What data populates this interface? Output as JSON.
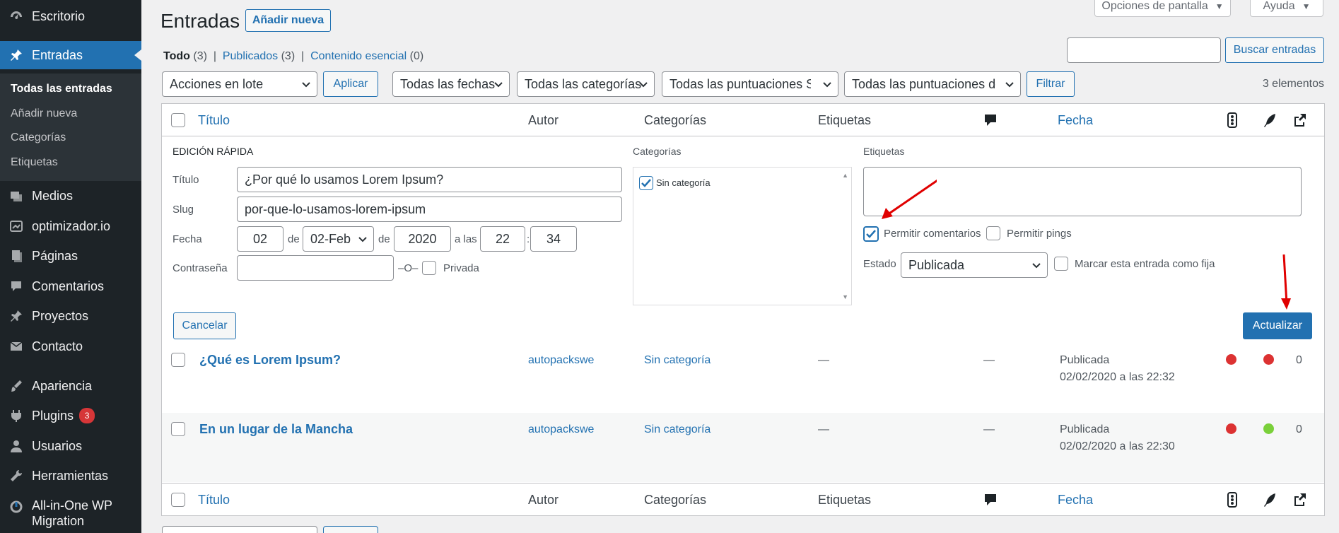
{
  "sidebar": {
    "menu": [
      {
        "label": "Escritorio",
        "icon": "dashboard-icon"
      },
      {
        "label": "Entradas",
        "icon": "pin-icon"
      },
      {
        "label": "Medios",
        "icon": "media-icon"
      },
      {
        "label": "optimizador.io",
        "icon": "optimizer-icon"
      },
      {
        "label": "Páginas",
        "icon": "pages-icon"
      },
      {
        "label": "Comentarios",
        "icon": "comments-icon"
      },
      {
        "label": "Proyectos",
        "icon": "pin-icon"
      },
      {
        "label": "Contacto",
        "icon": "mail-icon"
      },
      {
        "label": "Apariencia",
        "icon": "brush-icon"
      },
      {
        "label": "Plugins",
        "icon": "plugin-icon",
        "badge": "3"
      },
      {
        "label": "Usuarios",
        "icon": "user-icon"
      },
      {
        "label": "Herramientas",
        "icon": "wrench-icon"
      },
      {
        "label": "All-in-One WP Migration",
        "icon": "migration-icon"
      }
    ],
    "submenu": [
      "Todas las entradas",
      "Añadir nueva",
      "Categorías",
      "Etiquetas"
    ]
  },
  "header": {
    "title": "Entradas",
    "add_new": "Añadir nueva",
    "screen_options": "Opciones de pantalla",
    "help": "Ayuda",
    "search_button": "Buscar entradas"
  },
  "views": [
    {
      "label": "Todo",
      "count": "(3)"
    },
    {
      "label": "Publicados",
      "count": "(3)"
    },
    {
      "label": "Contenido esencial",
      "count": "(0)"
    }
  ],
  "filters": {
    "bulk": "Acciones en lote",
    "apply": "Aplicar",
    "dates": "Todas las fechas",
    "categories": "Todas las categorías",
    "seo": "Todas las puntuaciones SEO",
    "readability": "Todas las puntuaciones de legibilidad",
    "filter": "Filtrar",
    "items": "3 elementos"
  },
  "columns": {
    "title": "Título",
    "author": "Autor",
    "categories": "Categorías",
    "tags": "Etiquetas",
    "date": "Fecha"
  },
  "quick_edit": {
    "heading": "EDICIÓN RÁPIDA",
    "title_label": "Título",
    "title_value": "¿Por qué lo usamos Lorem Ipsum?",
    "slug_label": "Slug",
    "slug_value": "por-que-lo-usamos-lorem-ipsum",
    "date_label": "Fecha",
    "day": "02",
    "de1": "de",
    "month": "02-Feb",
    "de2": "de",
    "year": "2020",
    "at": "a las",
    "hour": "22",
    "colon": ":",
    "minute": "34",
    "password_label": "Contraseña",
    "or": "–O–",
    "private": "Privada",
    "categories_label": "Categorías",
    "category_item": "Sin categoría",
    "tags_label": "Etiquetas",
    "allow_comments": "Permitir comentarios",
    "allow_pings": "Permitir pings",
    "status_label": "Estado",
    "status_value": "Publicada",
    "sticky": "Marcar esta entrada como fija",
    "cancel": "Cancelar",
    "update": "Actualizar"
  },
  "rows": [
    {
      "title": "¿Qué es Lorem Ipsum?",
      "author": "autopackswe",
      "category": "Sin categoría",
      "tags": "—",
      "comments": "—",
      "status": "Publicada",
      "date": "02/02/2020 a las 22:32",
      "seo_color": "#dc3232",
      "read_color": "#dc3232",
      "links": "0"
    },
    {
      "title": "En un lugar de la Mancha",
      "author": "autopackswe",
      "category": "Sin categoría",
      "tags": "—",
      "comments": "—",
      "status": "Publicada",
      "date": "02/02/2020 a las 22:30",
      "seo_color": "#dc3232",
      "read_color": "#7ad03a",
      "links": "0"
    }
  ],
  "colors": {
    "accent": "#2271b1",
    "sidebar": "#1d2327",
    "arrow": "#e00000"
  }
}
